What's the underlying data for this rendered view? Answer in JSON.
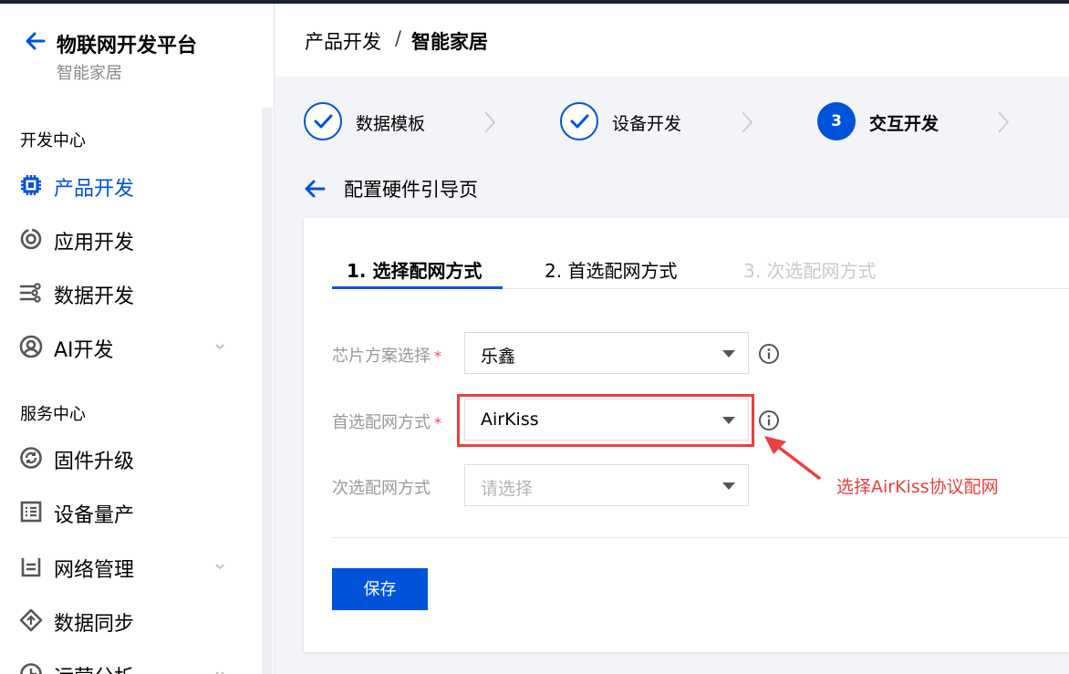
{
  "app": {
    "title": "物联网开发平台",
    "subtitle": "智能家居"
  },
  "sidebar": {
    "groups": [
      {
        "title": "开发中心",
        "items": [
          {
            "label": "产品开发",
            "icon": "chip-icon",
            "active": true
          },
          {
            "label": "应用开发",
            "icon": "app-icon"
          },
          {
            "label": "数据开发",
            "icon": "data-flow-icon"
          },
          {
            "label": "AI开发",
            "icon": "ai-icon",
            "expandable": true
          }
        ]
      },
      {
        "title": "服务中心",
        "items": [
          {
            "label": "固件升级",
            "icon": "firmware-icon"
          },
          {
            "label": "设备量产",
            "icon": "batch-icon"
          },
          {
            "label": "网络管理",
            "icon": "network-icon",
            "expandable": true
          },
          {
            "label": "数据同步",
            "icon": "sync-icon"
          },
          {
            "label": "运营分析",
            "icon": "analytics-icon",
            "expandable": true
          }
        ]
      }
    ]
  },
  "breadcrumb": {
    "parent": "产品开发",
    "separator": "/",
    "current": "智能家居"
  },
  "steps": [
    {
      "label": "数据模板",
      "state": "done"
    },
    {
      "label": "设备开发",
      "state": "done"
    },
    {
      "number": "3",
      "label": "交互开发",
      "state": "current"
    }
  ],
  "page": {
    "title": "配置硬件引导页"
  },
  "tabs": [
    {
      "label": "1. 选择配网方式",
      "state": "active"
    },
    {
      "label": "2. 首选配网方式",
      "state": "enabled"
    },
    {
      "label": "3. 次选配网方式",
      "state": "disabled"
    }
  ],
  "form": {
    "chip": {
      "label": "芯片方案选择",
      "required": "*",
      "value": "乐鑫"
    },
    "primary": {
      "label": "首选配网方式",
      "required": "*",
      "value": "AirKiss"
    },
    "secondary": {
      "label": "次选配网方式",
      "placeholder": "请选择"
    }
  },
  "actions": {
    "save": "保存"
  },
  "annotation": {
    "text": "选择AirKiss协议配网",
    "color": "#e8413e"
  },
  "colors": {
    "primary": "#0052d9",
    "annotation": "#e8413e"
  }
}
